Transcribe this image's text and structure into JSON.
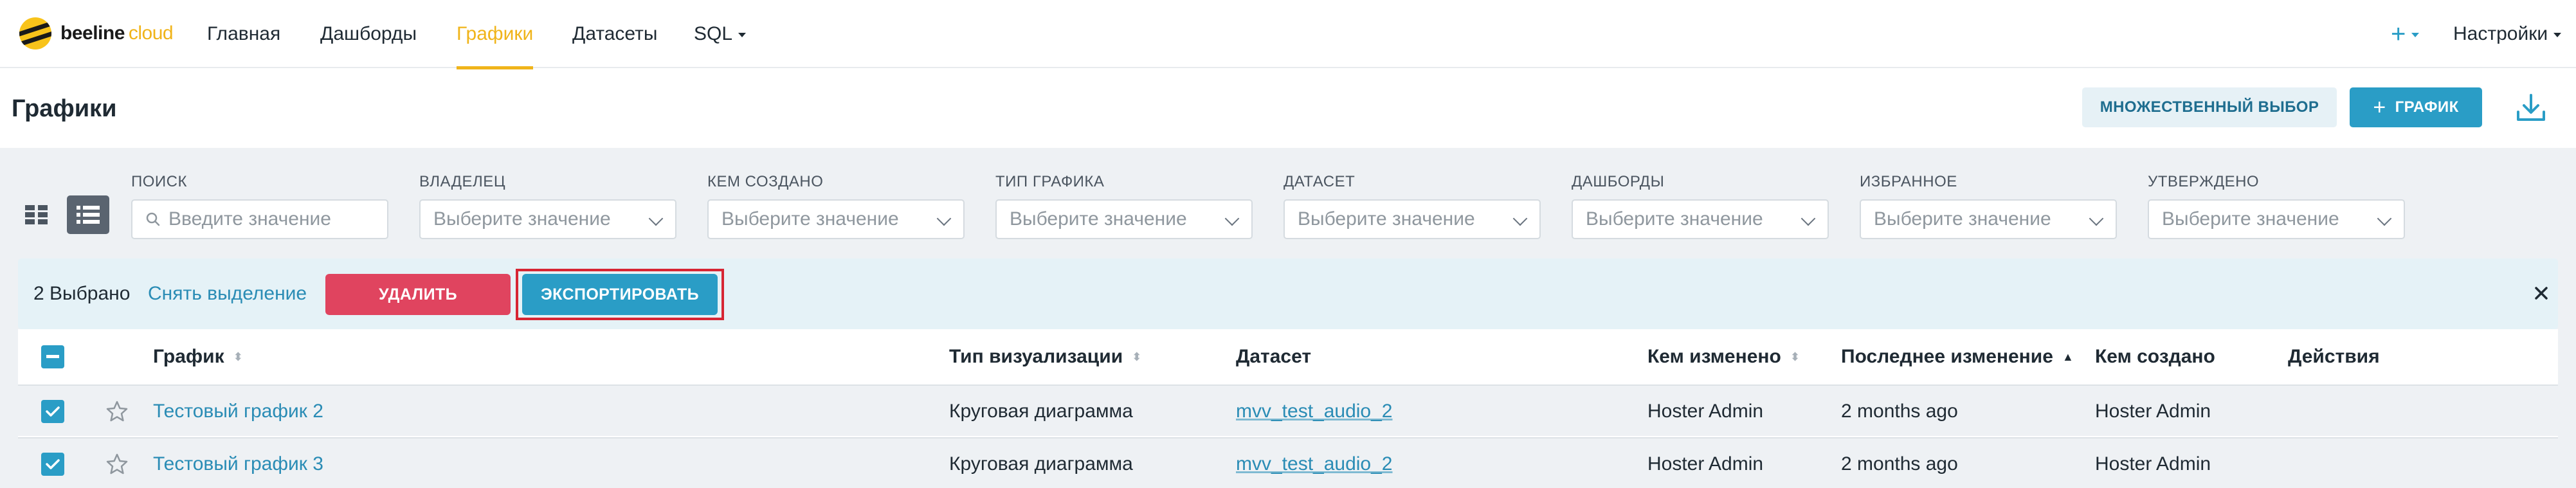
{
  "brand": {
    "name": "beeline",
    "suffix": "cloud"
  },
  "nav": {
    "items": [
      {
        "label": "Главная"
      },
      {
        "label": "Дашборды"
      },
      {
        "label": "Графики",
        "active": true
      },
      {
        "label": "Датасеты"
      },
      {
        "label": "SQL"
      }
    ],
    "plus_label": "+",
    "settings_label": "Настройки"
  },
  "header": {
    "title": "Графики",
    "multi_select_label": "МНОЖЕСТВЕННЫЙ ВЫБОР",
    "add_chart_label": "ГРАФИК",
    "add_chart_icon": "+"
  },
  "filters": [
    {
      "label": "ПОИСК",
      "placeholder": "Введите значение",
      "type": "search"
    },
    {
      "label": "ВЛАДЕЛЕЦ",
      "placeholder": "Выберите значение",
      "type": "select"
    },
    {
      "label": "КЕМ СОЗДАНО",
      "placeholder": "Выберите значение",
      "type": "select"
    },
    {
      "label": "ТИП ГРАФИКА",
      "placeholder": "Выберите значение",
      "type": "select"
    },
    {
      "label": "ДАТАСЕТ",
      "placeholder": "Выберите значение",
      "type": "select"
    },
    {
      "label": "ДАШБОРДЫ",
      "placeholder": "Выберите значение",
      "type": "select"
    },
    {
      "label": "ИЗБРАННОЕ",
      "placeholder": "Выберите значение",
      "type": "select"
    },
    {
      "label": "УТВЕРЖДЕНО",
      "placeholder": "Выберите значение",
      "type": "select"
    }
  ],
  "selection": {
    "count_label": "2 Выбрано",
    "clear_label": "Снять выделение",
    "delete_label": "УДАЛИТЬ",
    "export_label": "ЭКСПОРТИРОВАТЬ",
    "close_icon": "×"
  },
  "table": {
    "columns": [
      {
        "label": "График"
      },
      {
        "label": "Тип визуализации"
      },
      {
        "label": "Датасет"
      },
      {
        "label": "Кем изменено"
      },
      {
        "label": "Последнее изменение"
      },
      {
        "label": "Кем создано"
      },
      {
        "label": "Действия"
      }
    ],
    "rows": [
      {
        "name": "Тестовый график 2",
        "viz_type": "Круговая диаграмма",
        "dataset": "mvv_test_audio_2",
        "changed_by": "Hoster Admin",
        "last_modified": "2 months ago",
        "created_by": "Hoster Admin"
      },
      {
        "name": "Тестовый график 3",
        "viz_type": "Круговая диаграмма",
        "dataset": "mvv_test_audio_2",
        "changed_by": "Hoster Admin",
        "last_modified": "2 months ago",
        "created_by": "Hoster Admin"
      }
    ]
  },
  "colors": {
    "accent": "#f0b41a",
    "primary": "#2a9dc6",
    "danger": "#e0445f",
    "highlight": "#d72634"
  }
}
